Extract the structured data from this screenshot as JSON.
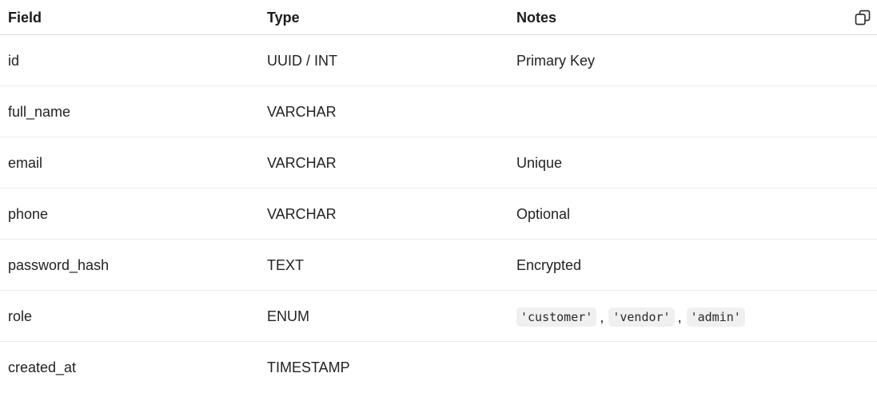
{
  "table": {
    "headers": {
      "field": "Field",
      "type": "Type",
      "notes": "Notes"
    },
    "copy_button": {
      "icon": "copy-icon"
    },
    "rows": [
      {
        "field": "id",
        "type": "UUID / INT",
        "notes": "Primary Key"
      },
      {
        "field": "full_name",
        "type": "VARCHAR",
        "notes": ""
      },
      {
        "field": "email",
        "type": "VARCHAR",
        "notes": "Unique"
      },
      {
        "field": "phone",
        "type": "VARCHAR",
        "notes": "Optional"
      },
      {
        "field": "password_hash",
        "type": "TEXT",
        "notes": "Encrypted"
      },
      {
        "field": "role",
        "type": "ENUM",
        "notes_codes": [
          "'customer'",
          "'vendor'",
          "'admin'"
        ],
        "separator": ","
      },
      {
        "field": "created_at",
        "type": "TIMESTAMP",
        "notes": ""
      }
    ]
  }
}
